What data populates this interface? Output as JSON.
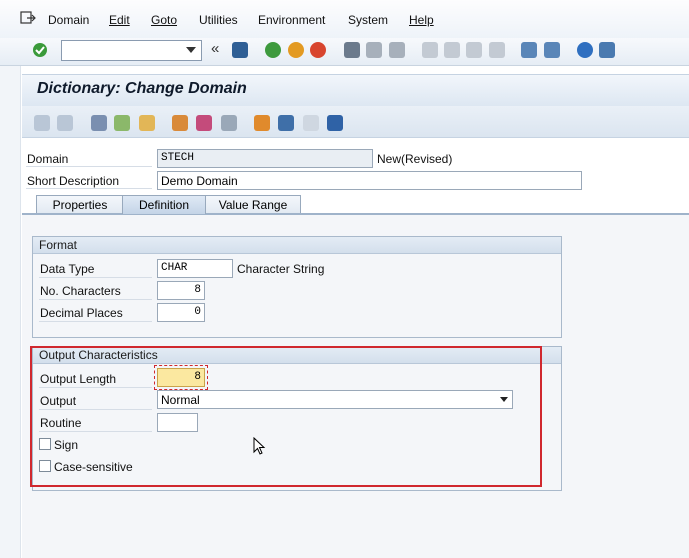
{
  "menu": {
    "items": [
      {
        "label": "Domain",
        "underline": false
      },
      {
        "label": "Edit",
        "underline": true
      },
      {
        "label": "Goto",
        "underline": true
      },
      {
        "label": "Utilities",
        "underline": false
      },
      {
        "label": "Environment",
        "underline": false
      },
      {
        "label": "System",
        "underline": false
      },
      {
        "label": "Help",
        "underline": true
      }
    ]
  },
  "toolbar": {
    "command_value": "",
    "icons": [
      "enter-icon",
      "back-icon",
      "exit-icon",
      "cancel-icon",
      "print-icon",
      "find-icon",
      "find-next-icon",
      "first-page-icon",
      "prev-page-icon",
      "next-page-icon",
      "last-page-icon",
      "new-session-icon",
      "shortcut-icon",
      "help-icon",
      "layout-icon"
    ]
  },
  "page": {
    "title": "Dictionary: Change Domain"
  },
  "header": {
    "domain_label": "Domain",
    "domain_value": "STECH",
    "domain_status": "New(Revised)",
    "short_desc_label": "Short Description",
    "short_desc_value": "Demo Domain"
  },
  "tabs": [
    {
      "label": "Properties",
      "active": false
    },
    {
      "label": "Definition",
      "active": true
    },
    {
      "label": "Value Range",
      "active": false
    }
  ],
  "format": {
    "title": "Format",
    "data_type_label": "Data Type",
    "data_type_value": "CHAR",
    "data_type_desc": "Character String",
    "no_chars_label": "No. Characters",
    "no_chars_value": "8",
    "decimal_label": "Decimal Places",
    "decimal_value": "0"
  },
  "output": {
    "title": "Output Characteristics",
    "length_label": "Output Length",
    "length_value": "8",
    "output_label": "Output",
    "output_value": "Normal",
    "routine_label": "Routine",
    "routine_value": "",
    "sign_label": "Sign",
    "sign_checked": false,
    "case_label": "Case-sensitive",
    "case_checked": false
  },
  "colors": {
    "highlight": "#d0282e",
    "focused_field": "#fbe8a0"
  }
}
